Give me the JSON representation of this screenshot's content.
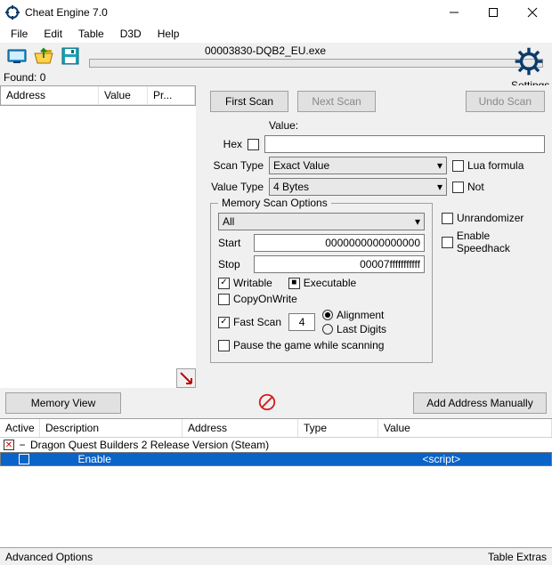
{
  "window": {
    "title": "Cheat Engine 7.0"
  },
  "menu": {
    "file": "File",
    "edit": "Edit",
    "table": "Table",
    "d3d": "D3D",
    "help": "Help"
  },
  "process": {
    "name": "00003830-DQB2_EU.exe"
  },
  "settings": {
    "label": "Settings"
  },
  "found": {
    "label": "Found: 0"
  },
  "left_headers": {
    "address": "Address",
    "value": "Value",
    "previous": "Pr..."
  },
  "scan_buttons": {
    "first": "First Scan",
    "next": "Next Scan",
    "undo": "Undo Scan"
  },
  "value_row": {
    "label": "Value:",
    "hex": "Hex",
    "input": ""
  },
  "scan_type": {
    "label": "Scan Type",
    "selected": "Exact Value"
  },
  "value_type": {
    "label": "Value Type",
    "selected": "4 Bytes"
  },
  "side_checks": {
    "lua": "Lua formula",
    "not": "Not",
    "unrandomizer": "Unrandomizer",
    "speedhack": "Enable Speedhack"
  },
  "mem_opts": {
    "legend": "Memory Scan Options",
    "region": "All",
    "start_label": "Start",
    "start": "0000000000000000",
    "stop_label": "Stop",
    "stop": "00007fffffffffff",
    "writable": "Writable",
    "executable": "Executable",
    "copyonwrite": "CopyOnWrite",
    "fastscan": "Fast Scan",
    "fastscan_val": "4",
    "alignment": "Alignment",
    "lastdigits": "Last Digits",
    "pause": "Pause the game while scanning"
  },
  "mid": {
    "memview": "Memory View",
    "addmanual": "Add Address Manually"
  },
  "table_headers": {
    "active": "Active",
    "description": "Description",
    "address": "Address",
    "type": "Type",
    "value": "Value"
  },
  "rows": [
    {
      "active_x": "✕",
      "desc": "Dragon Quest Builders 2 Release Version (Steam)",
      "addr": "",
      "type": "",
      "value": ""
    },
    {
      "active_x": "",
      "desc": "Enable",
      "addr": "",
      "type": "<script>",
      "value": ""
    }
  ],
  "status": {
    "left": "Advanced Options",
    "right": "Table Extras"
  }
}
